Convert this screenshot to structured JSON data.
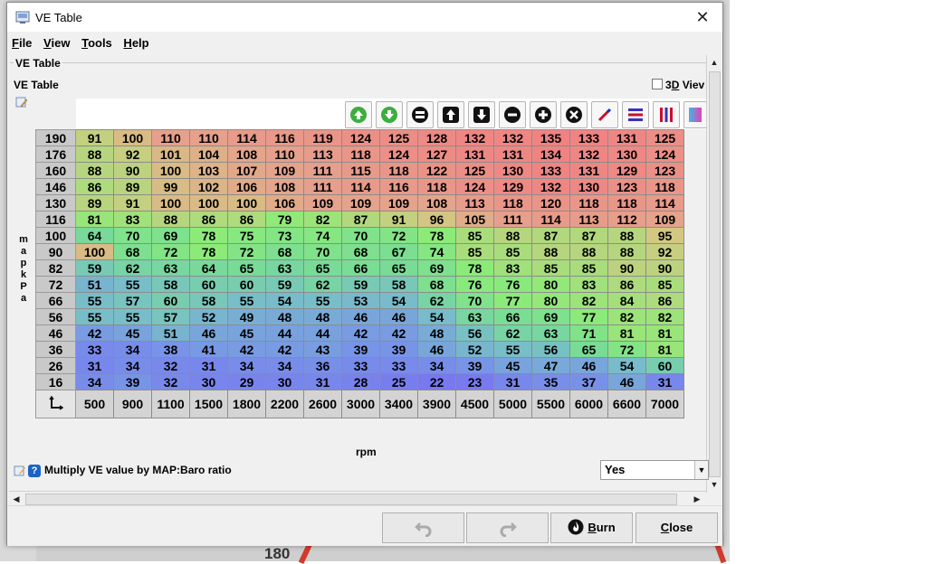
{
  "window": {
    "title": "VE Table",
    "close_glyph": "✕"
  },
  "menu": [
    {
      "mnemonic": "F",
      "rest": "ile"
    },
    {
      "mnemonic": "V",
      "rest": "iew"
    },
    {
      "mnemonic": "T",
      "rest": "ools"
    },
    {
      "mnemonic": "H",
      "rest": "elp"
    }
  ],
  "panel": {
    "title": "VE Table",
    "subtitle": "VE Table"
  },
  "view3d": {
    "pre": "3",
    "mnemonic": "D",
    "post": " Viev"
  },
  "toolbar": {
    "icons": [
      "increase-icon",
      "decrease-icon",
      "equals-icon",
      "shift-up-icon",
      "shift-down-icon",
      "minus-icon",
      "plus-icon",
      "clear-icon",
      "pen-icon",
      "list-icon",
      "color-bars-icon",
      "gradient-icon"
    ]
  },
  "table": {
    "y_axis_label": "map kPa",
    "y_axis_letters": [
      "m",
      "a",
      "p",
      "",
      "k",
      "P",
      "a"
    ],
    "x_axis_label": "rpm",
    "y_values": [
      "190",
      "176",
      "160",
      "146",
      "130",
      "116",
      "100",
      "90",
      "82",
      "72",
      "66",
      "56",
      "46",
      "36",
      "26",
      "16"
    ],
    "x_values": [
      "500",
      "900",
      "1100",
      "1500",
      "1800",
      "2200",
      "2600",
      "3000",
      "3400",
      "3900",
      "4500",
      "5000",
      "5500",
      "6000",
      "6600",
      "7000"
    ],
    "rows": [
      [
        91,
        100,
        110,
        110,
        114,
        116,
        119,
        124,
        125,
        128,
        132,
        132,
        135,
        133,
        131,
        125
      ],
      [
        88,
        92,
        101,
        104,
        108,
        110,
        113,
        118,
        124,
        127,
        131,
        131,
        134,
        132,
        130,
        124
      ],
      [
        88,
        90,
        100,
        103,
        107,
        109,
        111,
        115,
        118,
        122,
        125,
        130,
        133,
        131,
        129,
        123
      ],
      [
        86,
        89,
        99,
        102,
        106,
        108,
        111,
        114,
        116,
        118,
        124,
        129,
        132,
        130,
        123,
        118
      ],
      [
        89,
        91,
        100,
        100,
        100,
        106,
        109,
        109,
        109,
        108,
        113,
        118,
        120,
        118,
        118,
        114
      ],
      [
        81,
        83,
        88,
        86,
        86,
        79,
        82,
        87,
        91,
        96,
        105,
        111,
        114,
        113,
        112,
        109
      ],
      [
        64,
        70,
        69,
        78,
        75,
        73,
        74,
        70,
        72,
        78,
        85,
        88,
        87,
        87,
        88,
        95
      ],
      [
        100,
        68,
        72,
        78,
        72,
        68,
        70,
        68,
        67,
        74,
        85,
        85,
        88,
        88,
        88,
        92
      ],
      [
        59,
        62,
        63,
        64,
        65,
        63,
        65,
        66,
        65,
        69,
        78,
        83,
        85,
        85,
        90,
        90
      ],
      [
        51,
        55,
        58,
        60,
        60,
        59,
        62,
        59,
        58,
        68,
        76,
        76,
        80,
        83,
        86,
        85
      ],
      [
        55,
        57,
        60,
        58,
        55,
        54,
        55,
        53,
        54,
        62,
        70,
        77,
        80,
        82,
        84,
        86
      ],
      [
        55,
        55,
        57,
        52,
        49,
        48,
        48,
        46,
        46,
        54,
        63,
        66,
        69,
        77,
        82,
        82
      ],
      [
        42,
        45,
        51,
        46,
        45,
        44,
        44,
        42,
        42,
        48,
        56,
        62,
        63,
        71,
        81,
        81
      ],
      [
        33,
        34,
        38,
        41,
        42,
        42,
        43,
        39,
        39,
        46,
        52,
        55,
        56,
        65,
        72,
        81
      ],
      [
        31,
        34,
        32,
        31,
        34,
        34,
        36,
        33,
        33,
        34,
        39,
        45,
        47,
        46,
        54,
        60
      ],
      [
        34,
        39,
        32,
        30,
        29,
        30,
        31,
        28,
        25,
        22,
        23,
        31,
        35,
        37,
        46,
        31
      ]
    ]
  },
  "parameter": {
    "label": "Multiply VE value by MAP:Baro ratio",
    "value": "Yes"
  },
  "buttons": {
    "undo": "undo-icon",
    "redo": "redo-icon",
    "burn_pre": "",
    "burn_mnemonic": "B",
    "burn_post": "urn",
    "close_mnemonic": "C",
    "close_post": "lose"
  },
  "background": {
    "gauge_value": "180"
  }
}
